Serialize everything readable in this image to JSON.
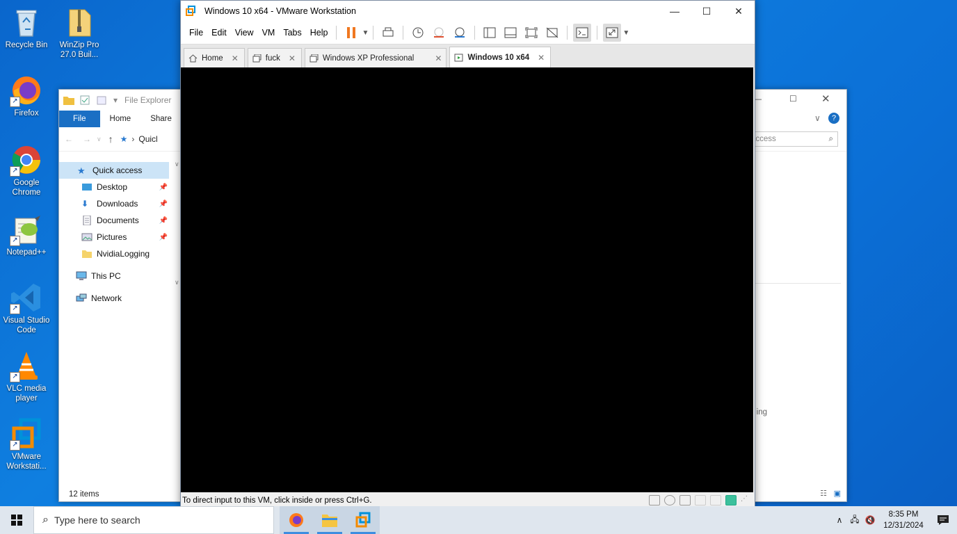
{
  "desktop": {
    "icons": [
      {
        "label": "Recycle Bin",
        "icon": "recycle-bin-icon"
      },
      {
        "label": "WinZip Pro 27.0 Buil...",
        "icon": "winzip-icon"
      },
      {
        "label": "Firefox",
        "icon": "firefox-icon"
      },
      {
        "label": "Google Chrome",
        "icon": "chrome-icon"
      },
      {
        "label": "Notepad++",
        "icon": "notepadpp-icon"
      },
      {
        "label": "Visual Studio Code",
        "icon": "vscode-icon"
      },
      {
        "label": "VLC media player",
        "icon": "vlc-icon"
      },
      {
        "label": "VMware Workstati...",
        "icon": "vmware-icon"
      }
    ]
  },
  "explorer": {
    "title": "File Explorer",
    "ribbon_tabs": [
      "File",
      "Home",
      "Share"
    ],
    "address": "Quicl",
    "search_placeholder": "access",
    "nav": {
      "quick_access": "Quick access",
      "items": [
        "Desktop",
        "Downloads",
        "Documents",
        "Pictures",
        "NvidiaLogging"
      ],
      "this_pc": "This PC",
      "network": "Network"
    },
    "partial_right_text": "ing",
    "status": "12 items"
  },
  "vmware": {
    "title": "Windows 10 x64 - VMware Workstation",
    "menu": [
      "File",
      "Edit",
      "View",
      "VM",
      "Tabs",
      "Help"
    ],
    "tabs": [
      {
        "label": "Home",
        "active": false
      },
      {
        "label": "fuck",
        "active": false
      },
      {
        "label": "Windows XP Professional",
        "active": false
      },
      {
        "label": "Windows 10 x64",
        "active": true
      }
    ],
    "status_text": "To direct input to this VM, click inside or press Ctrl+G."
  },
  "taskbar": {
    "search_placeholder": "Type here to search",
    "apps": [
      "firefox-icon",
      "file-explorer-icon",
      "vmware-icon"
    ],
    "time": "8:35 PM",
    "date": "12/31/2024"
  }
}
